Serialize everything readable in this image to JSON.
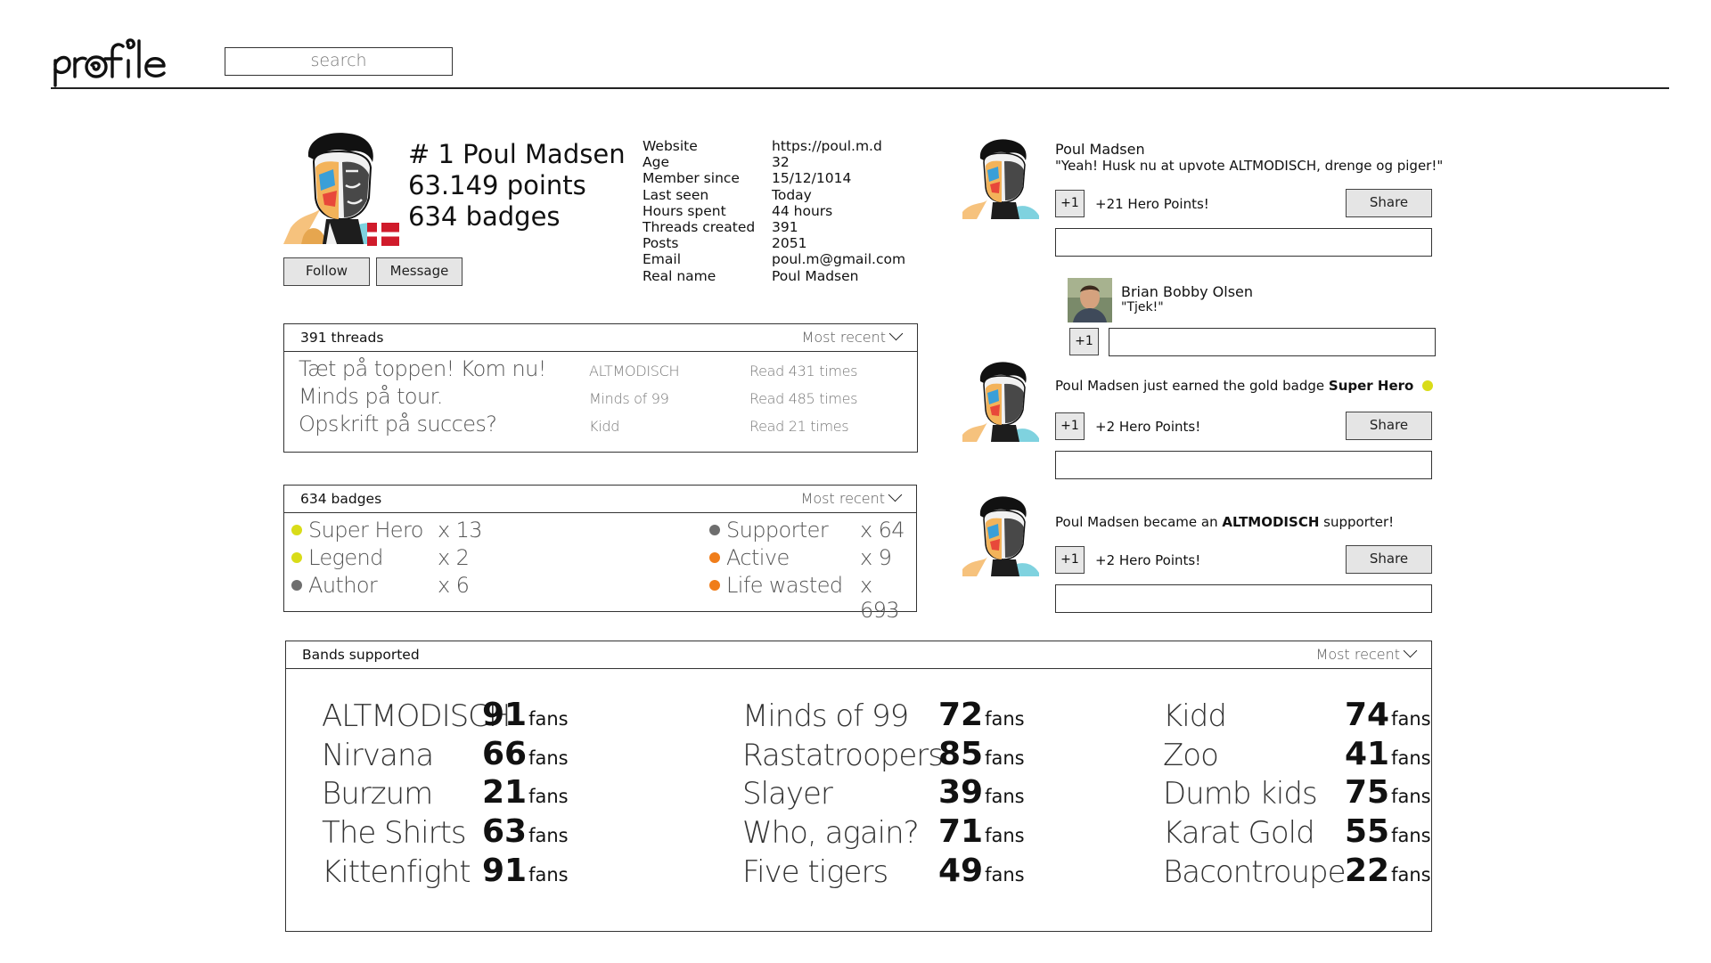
{
  "header": {
    "logo_text": "profile",
    "search_placeholder": "search"
  },
  "profile": {
    "rank_line": "# 1 Poul Madsen",
    "points_line": "63.149 points",
    "badges_line": "634 badges",
    "follow_label": "Follow",
    "message_label": "Message",
    "flag": "Denmark",
    "info": [
      {
        "key": "Website",
        "value": "https://poul.m.d"
      },
      {
        "key": "Age",
        "value": "32"
      },
      {
        "key": "Member since",
        "value": "15/12/1014"
      },
      {
        "key": "Last seen",
        "value": "Today"
      },
      {
        "key": "Hours spent",
        "value": "44 hours"
      },
      {
        "key": "Threads created",
        "value": "391"
      },
      {
        "key": "Posts",
        "value": "2051"
      },
      {
        "key": "Email",
        "value": "poul.m@gmail.com"
      },
      {
        "key": "Real name",
        "value": "Poul Madsen"
      }
    ]
  },
  "threads": {
    "title": "391 threads",
    "sort_label": "Most recent",
    "rows": [
      {
        "title": "Tæt på toppen! Kom nu!",
        "band": "ALTMODISCH",
        "reads": "Read 431 times"
      },
      {
        "title": "Minds på tour.",
        "band": "Minds of 99",
        "reads": "Read 485 times"
      },
      {
        "title": "Opskrift på succes?",
        "band": "Kidd",
        "reads": "Read 21 times"
      }
    ]
  },
  "badges": {
    "title": "634 badges",
    "sort_label": "Most recent",
    "items": [
      {
        "name": "Super Hero",
        "count": "x 13",
        "color": "#d9dc18"
      },
      {
        "name": "Legend",
        "count": "x 2",
        "color": "#d9dc18"
      },
      {
        "name": "Author",
        "count": "x 6",
        "color": "#6e6e6e"
      },
      {
        "name": "Supporter",
        "count": "x 64",
        "color": "#6e6e6e"
      },
      {
        "name": "Active",
        "count": "x 9",
        "color": "#f07d1a"
      },
      {
        "name": "Life wasted",
        "count": "x 693",
        "color": "#f07d1a"
      }
    ]
  },
  "bands": {
    "title": "Bands supported",
    "sort_label": "Most recent",
    "fans_label": "fans",
    "items": [
      {
        "name": "ALTMODISCH",
        "fans": "91"
      },
      {
        "name": "Nirvana",
        "fans": "66"
      },
      {
        "name": "Burzum",
        "fans": "21"
      },
      {
        "name": "The Shirts",
        "fans": "63"
      },
      {
        "name": "Kittenfight",
        "fans": "91"
      },
      {
        "name": "Minds of 99",
        "fans": "72"
      },
      {
        "name": "Rastatroopers",
        "fans": "85"
      },
      {
        "name": "Slayer",
        "fans": "39"
      },
      {
        "name": "Who, again?",
        "fans": "71"
      },
      {
        "name": "Five tigers",
        "fans": "49"
      },
      {
        "name": "Kidd",
        "fans": "74"
      },
      {
        "name": "Zoo",
        "fans": "41"
      },
      {
        "name": "Dumb kids",
        "fans": "75"
      },
      {
        "name": "Karat Gold",
        "fans": "55"
      },
      {
        "name": "Bacontroupe",
        "fans": "22"
      }
    ]
  },
  "feed": {
    "post1": {
      "author": "Poul Madsen",
      "quote": "\"Yeah! Husk nu at upvote ALTMODISCH, drenge og piger!\"",
      "plus_label": "+1",
      "points": "+21 Hero Points!",
      "share_label": "Share"
    },
    "reply": {
      "author": "Brian Bobby Olsen",
      "quote": "\"Tjek!\"",
      "plus_label": "+1"
    },
    "post2": {
      "author": "Poul Madsen",
      "text_pre": " just earned the gold badge ",
      "badge": "Super Hero",
      "badge_color": "#d9dc18",
      "plus_label": "+1",
      "points": "+2 Hero Points!",
      "share_label": "Share"
    },
    "post3": {
      "author": "Poul Madsen",
      "text_pre": " became an ",
      "band": "ALTMODISCH",
      "text_post": " supporter!",
      "plus_label": "+1",
      "points": "+2 Hero Points!",
      "share_label": "Share"
    }
  }
}
